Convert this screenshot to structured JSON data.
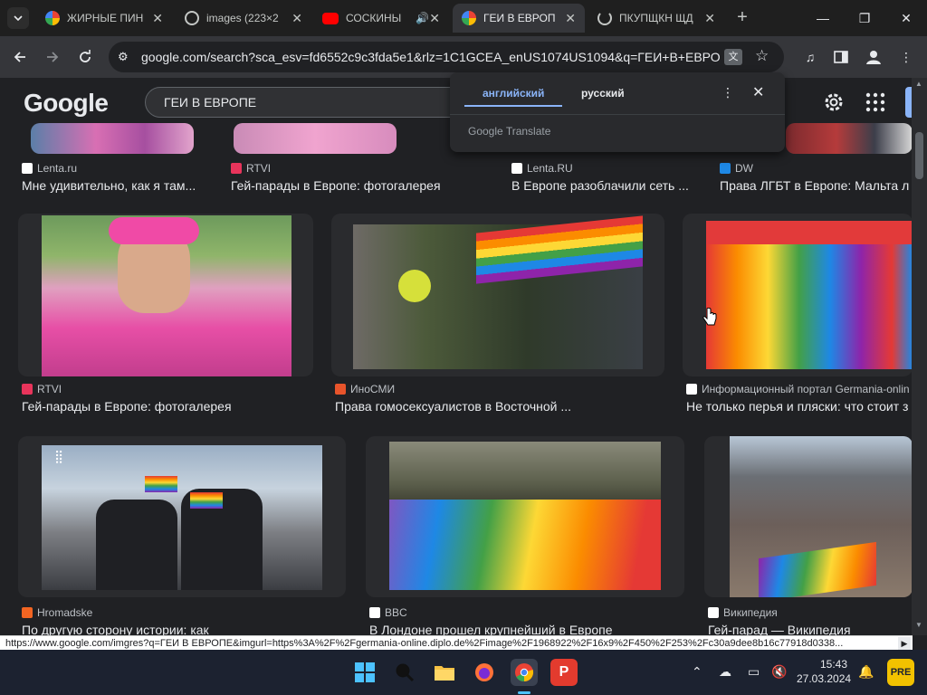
{
  "browser": {
    "tabs": [
      {
        "title": "ЖИРНЫЕ ПИН",
        "active": false
      },
      {
        "title": "images (223×2",
        "active": false
      },
      {
        "title": "СОСКИНЫ",
        "active": false
      },
      {
        "title": "ГЕИ В ЕВРОП",
        "active": true
      },
      {
        "title": "ПКУПЩКН ЩД",
        "active": false
      }
    ],
    "url": "google.com/search?sca_esv=fd6552c9c3fda5e1&rlz=1C1GCEA_enUS1074US1094&q=ГЕИ+В+ЕВРОП...",
    "window_controls": {
      "minimize": "—",
      "maximize": "❐",
      "close": "✕"
    }
  },
  "google": {
    "logo": "Google",
    "query": "ГЕИ В ЕВРОПЕ"
  },
  "translate_popup": {
    "lang_from": "английский",
    "lang_to": "русский",
    "brand": "Google Translate",
    "accent": "#8ab4f8"
  },
  "results": {
    "row0": [
      {
        "source": "Lenta.ru",
        "title": "Мне удивительно, как я там..."
      },
      {
        "source": "RTVI",
        "title": "Гей-парады в Европе: фотогалерея"
      },
      {
        "source": "Lenta.RU",
        "title": "В Европе разоблачили сеть ..."
      },
      {
        "source": "DW",
        "title": "Права ЛГБТ в Европе: Мальта л"
      }
    ],
    "row1": [
      {
        "source": "RTVI",
        "title": "Гей-парады в Европе: фотогалерея"
      },
      {
        "source": "ИноСМИ",
        "title": "Права гомосексуалистов в Восточной ..."
      },
      {
        "source": "Информационный портал Germania-onlin",
        "title": "Не только перья и пляски: что стоит з"
      }
    ],
    "row2": [
      {
        "source": "Hromadske",
        "title": "По другую сторону истории: как"
      },
      {
        "source": "BBC",
        "title": "В Лондоне прошел крупнейший в Европе"
      },
      {
        "source": "Википедия",
        "title": "Гей-парад — Википедия"
      }
    ]
  },
  "status_url": "https://www.google.com/imgres?q=ГЕИ В ЕВРОПЕ&imgurl=https%3A%2F%2Fgermania-online.diplo.de%2Fimage%2F1968922%2F16x9%2F450%2F253%2Fc30a9dee8b16c77918d0338...",
  "taskbar": {
    "time": "15:43",
    "date": "27.03.2024"
  }
}
